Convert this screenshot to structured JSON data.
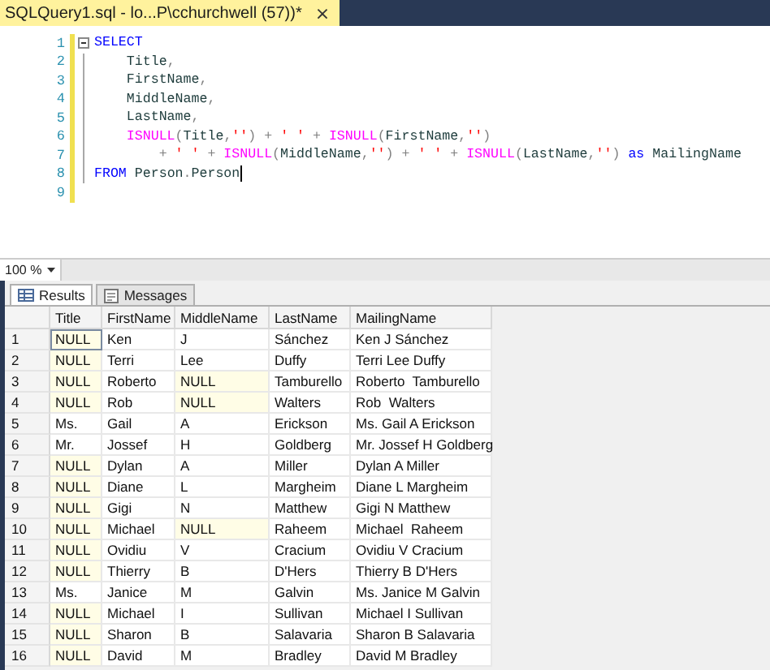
{
  "tab": {
    "title": "SQLQuery1.sql - lo...P\\cchurchwell (57))*",
    "close": "×",
    "modified": true
  },
  "editor": {
    "lines": [
      {
        "number": "1",
        "collapsible": true,
        "changed": true,
        "cursor": false,
        "tokens": [
          {
            "kind": "kw",
            "text": "SELECT"
          }
        ]
      },
      {
        "number": "2",
        "collapsible": false,
        "changed": true,
        "cursor": false,
        "tokens": [
          {
            "kind": "id",
            "text": "    Title"
          },
          {
            "kind": "op",
            "text": ","
          }
        ]
      },
      {
        "number": "3",
        "collapsible": false,
        "changed": true,
        "cursor": false,
        "tokens": [
          {
            "kind": "id",
            "text": "    FirstName"
          },
          {
            "kind": "op",
            "text": ","
          }
        ]
      },
      {
        "number": "4",
        "collapsible": false,
        "changed": true,
        "cursor": false,
        "tokens": [
          {
            "kind": "id",
            "text": "    MiddleName"
          },
          {
            "kind": "op",
            "text": ","
          }
        ]
      },
      {
        "number": "5",
        "collapsible": false,
        "changed": true,
        "cursor": false,
        "tokens": [
          {
            "kind": "id",
            "text": "    LastName"
          },
          {
            "kind": "op",
            "text": ","
          }
        ]
      },
      {
        "number": "6",
        "collapsible": false,
        "changed": true,
        "cursor": false,
        "tokens": [
          {
            "kind": "fn",
            "text": "    ISNULL"
          },
          {
            "kind": "op",
            "text": "("
          },
          {
            "kind": "id",
            "text": "Title"
          },
          {
            "kind": "op",
            "text": ","
          },
          {
            "kind": "str",
            "text": "''"
          },
          {
            "kind": "op",
            "text": ") + "
          },
          {
            "kind": "str",
            "text": "' '"
          },
          {
            "kind": "op",
            "text": " + "
          },
          {
            "kind": "fn",
            "text": "ISNULL"
          },
          {
            "kind": "op",
            "text": "("
          },
          {
            "kind": "id",
            "text": "FirstName"
          },
          {
            "kind": "op",
            "text": ","
          },
          {
            "kind": "str",
            "text": "''"
          },
          {
            "kind": "op",
            "text": ")"
          }
        ]
      },
      {
        "number": "7",
        "collapsible": false,
        "changed": true,
        "cursor": false,
        "tokens": [
          {
            "kind": "op",
            "text": "        + "
          },
          {
            "kind": "str",
            "text": "' '"
          },
          {
            "kind": "op",
            "text": " + "
          },
          {
            "kind": "fn",
            "text": "ISNULL"
          },
          {
            "kind": "op",
            "text": "("
          },
          {
            "kind": "id",
            "text": "MiddleName"
          },
          {
            "kind": "op",
            "text": ","
          },
          {
            "kind": "str",
            "text": "''"
          },
          {
            "kind": "op",
            "text": ") + "
          },
          {
            "kind": "str",
            "text": "' '"
          },
          {
            "kind": "op",
            "text": " + "
          },
          {
            "kind": "fn",
            "text": "ISNULL"
          },
          {
            "kind": "op",
            "text": "("
          },
          {
            "kind": "id",
            "text": "LastName"
          },
          {
            "kind": "op",
            "text": ","
          },
          {
            "kind": "str",
            "text": "''"
          },
          {
            "kind": "op",
            "text": ") "
          },
          {
            "kind": "kw",
            "text": "as"
          },
          {
            "kind": "id",
            "text": " MailingName"
          }
        ]
      },
      {
        "number": "8",
        "collapsible": false,
        "changed": true,
        "cursor": true,
        "tokens": [
          {
            "kind": "kw",
            "text": "FROM"
          },
          {
            "kind": "id",
            "text": " Person"
          },
          {
            "kind": "op",
            "text": "."
          },
          {
            "kind": "id",
            "text": "Person"
          }
        ]
      },
      {
        "number": "9",
        "collapsible": false,
        "changed": true,
        "cursor": false
      }
    ]
  },
  "zoom": "100 %",
  "result_tabs": [
    {
      "label": "Results",
      "selected": true,
      "kind": "grid"
    },
    {
      "label": "Messages",
      "selected": false,
      "kind": "messages"
    }
  ],
  "grid": {
    "columns": [
      "Title",
      "FirstName",
      "MiddleName",
      "LastName",
      "MailingName"
    ],
    "rows": [
      {
        "number": "1",
        "cells": [
          {
            "text": "NULL",
            "null": true,
            "selected": true
          },
          {
            "text": "Ken",
            "null": false,
            "selected": false
          },
          {
            "text": "J",
            "null": false,
            "selected": false
          },
          {
            "text": "Sánchez",
            "null": false,
            "selected": false
          },
          {
            "text": "Ken J Sánchez",
            "null": false,
            "selected": false
          }
        ]
      },
      {
        "number": "2",
        "cells": [
          {
            "text": "NULL",
            "null": true,
            "selected": false
          },
          {
            "text": "Terri",
            "null": false,
            "selected": false
          },
          {
            "text": "Lee",
            "null": false,
            "selected": false
          },
          {
            "text": "Duffy",
            "null": false,
            "selected": false
          },
          {
            "text": "Terri Lee Duffy",
            "null": false,
            "selected": false
          }
        ]
      },
      {
        "number": "3",
        "cells": [
          {
            "text": "NULL",
            "null": true,
            "selected": false
          },
          {
            "text": "Roberto",
            "null": false,
            "selected": false
          },
          {
            "text": "NULL",
            "null": true,
            "selected": false
          },
          {
            "text": "Tamburello",
            "null": false,
            "selected": false
          },
          {
            "text": "Roberto  Tamburello",
            "null": false,
            "selected": false
          }
        ]
      },
      {
        "number": "4",
        "cells": [
          {
            "text": "NULL",
            "null": true,
            "selected": false
          },
          {
            "text": "Rob",
            "null": false,
            "selected": false
          },
          {
            "text": "NULL",
            "null": true,
            "selected": false
          },
          {
            "text": "Walters",
            "null": false,
            "selected": false
          },
          {
            "text": "Rob  Walters",
            "null": false,
            "selected": false
          }
        ]
      },
      {
        "number": "5",
        "cells": [
          {
            "text": "Ms.",
            "null": false,
            "selected": false
          },
          {
            "text": "Gail",
            "null": false,
            "selected": false
          },
          {
            "text": "A",
            "null": false,
            "selected": false
          },
          {
            "text": "Erickson",
            "null": false,
            "selected": false
          },
          {
            "text": "Ms. Gail A Erickson",
            "null": false,
            "selected": false
          }
        ]
      },
      {
        "number": "6",
        "cells": [
          {
            "text": "Mr.",
            "null": false,
            "selected": false
          },
          {
            "text": "Jossef",
            "null": false,
            "selected": false
          },
          {
            "text": "H",
            "null": false,
            "selected": false
          },
          {
            "text": "Goldberg",
            "null": false,
            "selected": false
          },
          {
            "text": "Mr. Jossef H Goldberg",
            "null": false,
            "selected": false
          }
        ]
      },
      {
        "number": "7",
        "cells": [
          {
            "text": "NULL",
            "null": true,
            "selected": false
          },
          {
            "text": "Dylan",
            "null": false,
            "selected": false
          },
          {
            "text": "A",
            "null": false,
            "selected": false
          },
          {
            "text": "Miller",
            "null": false,
            "selected": false
          },
          {
            "text": "Dylan A Miller",
            "null": false,
            "selected": false
          }
        ]
      },
      {
        "number": "8",
        "cells": [
          {
            "text": "NULL",
            "null": true,
            "selected": false
          },
          {
            "text": "Diane",
            "null": false,
            "selected": false
          },
          {
            "text": "L",
            "null": false,
            "selected": false
          },
          {
            "text": "Margheim",
            "null": false,
            "selected": false
          },
          {
            "text": "Diane L Margheim",
            "null": false,
            "selected": false
          }
        ]
      },
      {
        "number": "9",
        "cells": [
          {
            "text": "NULL",
            "null": true,
            "selected": false
          },
          {
            "text": "Gigi",
            "null": false,
            "selected": false
          },
          {
            "text": "N",
            "null": false,
            "selected": false
          },
          {
            "text": "Matthew",
            "null": false,
            "selected": false
          },
          {
            "text": "Gigi N Matthew",
            "null": false,
            "selected": false
          }
        ]
      },
      {
        "number": "10",
        "cells": [
          {
            "text": "NULL",
            "null": true,
            "selected": false
          },
          {
            "text": "Michael",
            "null": false,
            "selected": false
          },
          {
            "text": "NULL",
            "null": true,
            "selected": false
          },
          {
            "text": "Raheem",
            "null": false,
            "selected": false
          },
          {
            "text": "Michael  Raheem",
            "null": false,
            "selected": false
          }
        ]
      },
      {
        "number": "11",
        "cells": [
          {
            "text": "NULL",
            "null": true,
            "selected": false
          },
          {
            "text": "Ovidiu",
            "null": false,
            "selected": false
          },
          {
            "text": "V",
            "null": false,
            "selected": false
          },
          {
            "text": "Cracium",
            "null": false,
            "selected": false
          },
          {
            "text": "Ovidiu V Cracium",
            "null": false,
            "selected": false
          }
        ]
      },
      {
        "number": "12",
        "cells": [
          {
            "text": "NULL",
            "null": true,
            "selected": false
          },
          {
            "text": "Thierry",
            "null": false,
            "selected": false
          },
          {
            "text": "B",
            "null": false,
            "selected": false
          },
          {
            "text": "D'Hers",
            "null": false,
            "selected": false
          },
          {
            "text": "Thierry B D'Hers",
            "null": false,
            "selected": false
          }
        ]
      },
      {
        "number": "13",
        "cells": [
          {
            "text": "Ms.",
            "null": false,
            "selected": false
          },
          {
            "text": "Janice",
            "null": false,
            "selected": false
          },
          {
            "text": "M",
            "null": false,
            "selected": false
          },
          {
            "text": "Galvin",
            "null": false,
            "selected": false
          },
          {
            "text": "Ms. Janice M Galvin",
            "null": false,
            "selected": false
          }
        ]
      },
      {
        "number": "14",
        "cells": [
          {
            "text": "NULL",
            "null": true,
            "selected": false
          },
          {
            "text": "Michael",
            "null": false,
            "selected": false
          },
          {
            "text": "I",
            "null": false,
            "selected": false
          },
          {
            "text": "Sullivan",
            "null": false,
            "selected": false
          },
          {
            "text": "Michael I Sullivan",
            "null": false,
            "selected": false
          }
        ]
      },
      {
        "number": "15",
        "cells": [
          {
            "text": "NULL",
            "null": true,
            "selected": false
          },
          {
            "text": "Sharon",
            "null": false,
            "selected": false
          },
          {
            "text": "B",
            "null": false,
            "selected": false
          },
          {
            "text": "Salavaria",
            "null": false,
            "selected": false
          },
          {
            "text": "Sharon B Salavaria",
            "null": false,
            "selected": false
          }
        ]
      },
      {
        "number": "16",
        "cells": [
          {
            "text": "NULL",
            "null": true,
            "selected": false
          },
          {
            "text": "David",
            "null": false,
            "selected": false
          },
          {
            "text": "M",
            "null": false,
            "selected": false
          },
          {
            "text": "Bradley",
            "null": false,
            "selected": false
          },
          {
            "text": "David M Bradley",
            "null": false,
            "selected": false
          }
        ]
      }
    ]
  }
}
